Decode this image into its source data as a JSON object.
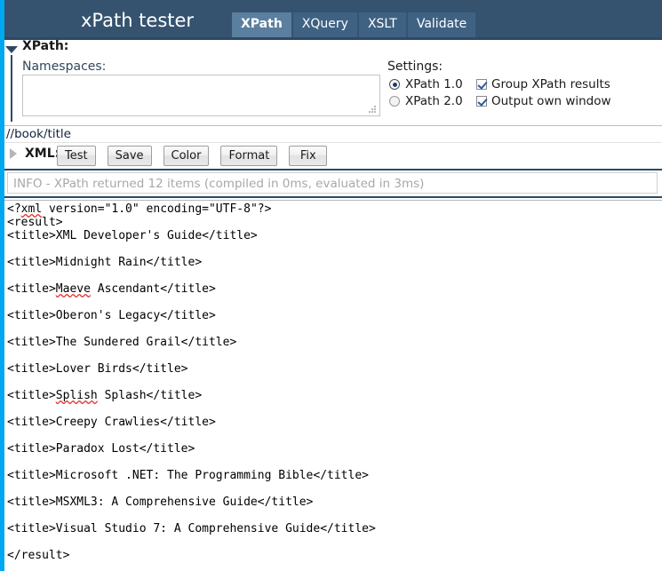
{
  "header": {
    "title": "xPath tester",
    "tabs": [
      {
        "label": "XPath",
        "active": true
      },
      {
        "label": "XQuery",
        "active": false
      },
      {
        "label": "XSLT",
        "active": false
      },
      {
        "label": "Validate",
        "active": false
      }
    ]
  },
  "xpath_panel": {
    "section_label": "XPath:",
    "namespaces_label": "Namespaces:",
    "namespaces_value": "",
    "namespaces_placeholder": "",
    "settings_label": "Settings:",
    "options": [
      {
        "name": "xpath-1-0",
        "type": "radio",
        "label": "XPath 1.0",
        "checked": true
      },
      {
        "name": "xpath-2-0",
        "type": "radio",
        "label": "XPath 2.0",
        "checked": false
      },
      {
        "name": "group-xpath-results",
        "type": "checkbox",
        "label": "Group XPath results",
        "checked": true
      },
      {
        "name": "output-own-window",
        "type": "checkbox",
        "label": "Output own window",
        "checked": true
      }
    ]
  },
  "expression": {
    "value": "//book/title",
    "placeholder": "//book/title"
  },
  "xml_toolbar": {
    "section_label": "XML:",
    "buttons": [
      {
        "name": "test",
        "label": "Test"
      },
      {
        "name": "save",
        "label": "Save"
      },
      {
        "name": "color",
        "label": "Color"
      },
      {
        "name": "format",
        "label": "Format"
      },
      {
        "name": "fix",
        "label": "Fix"
      }
    ]
  },
  "info": {
    "message": "INFO - XPath returned 12 items (compiled in 0ms, evaluated in 3ms)",
    "items_returned": 12,
    "compiled_ms": 0,
    "evaluated_ms": 3
  },
  "result": {
    "lines": [
      "<?xml version=\"1.0\" encoding=\"UTF-8\"?>",
      "<result>",
      "<title>XML Developer's Guide</title>",
      "",
      "<title>Midnight Rain</title>",
      "",
      "<title>Maeve Ascendant</title>",
      "",
      "<title>Oberon's Legacy</title>",
      "",
      "<title>The Sundered Grail</title>",
      "",
      "<title>Lover Birds</title>",
      "",
      "<title>Splish Splash</title>",
      "",
      "<title>Creepy Crawlies</title>",
      "",
      "<title>Paradox Lost</title>",
      "",
      "<title>Microsoft .NET: The Programming Bible</title>",
      "",
      "<title>MSXML3: A Comprehensive Guide</title>",
      "",
      "<title>Visual Studio 7: A Comprehensive Guide</title>",
      "",
      "</result>"
    ],
    "titles": [
      "XML Developer's Guide",
      "Midnight Rain",
      "Maeve Ascendant",
      "Oberon's Legacy",
      "The Sundered Grail",
      "Lover Birds",
      "Splish Splash",
      "Creepy Crawlies",
      "Paradox Lost",
      "Microsoft .NET: The Programming Bible",
      "MSXML3: A Comprehensive Guide",
      "Visual Studio 7: A Comprehensive Guide"
    ],
    "spellcheck_flagged_words": [
      "xml",
      "Maeve",
      "Splish"
    ]
  },
  "colors": {
    "header_bg": "#35536f",
    "tab_active_bg": "#5b7f9e",
    "tab_inactive_bg": "#3f6283",
    "accent_stripe": "#00a8f0",
    "divider": "#2d4a64",
    "info_text": "#a8a8a8",
    "spellcheck_underline": "#e03030"
  }
}
